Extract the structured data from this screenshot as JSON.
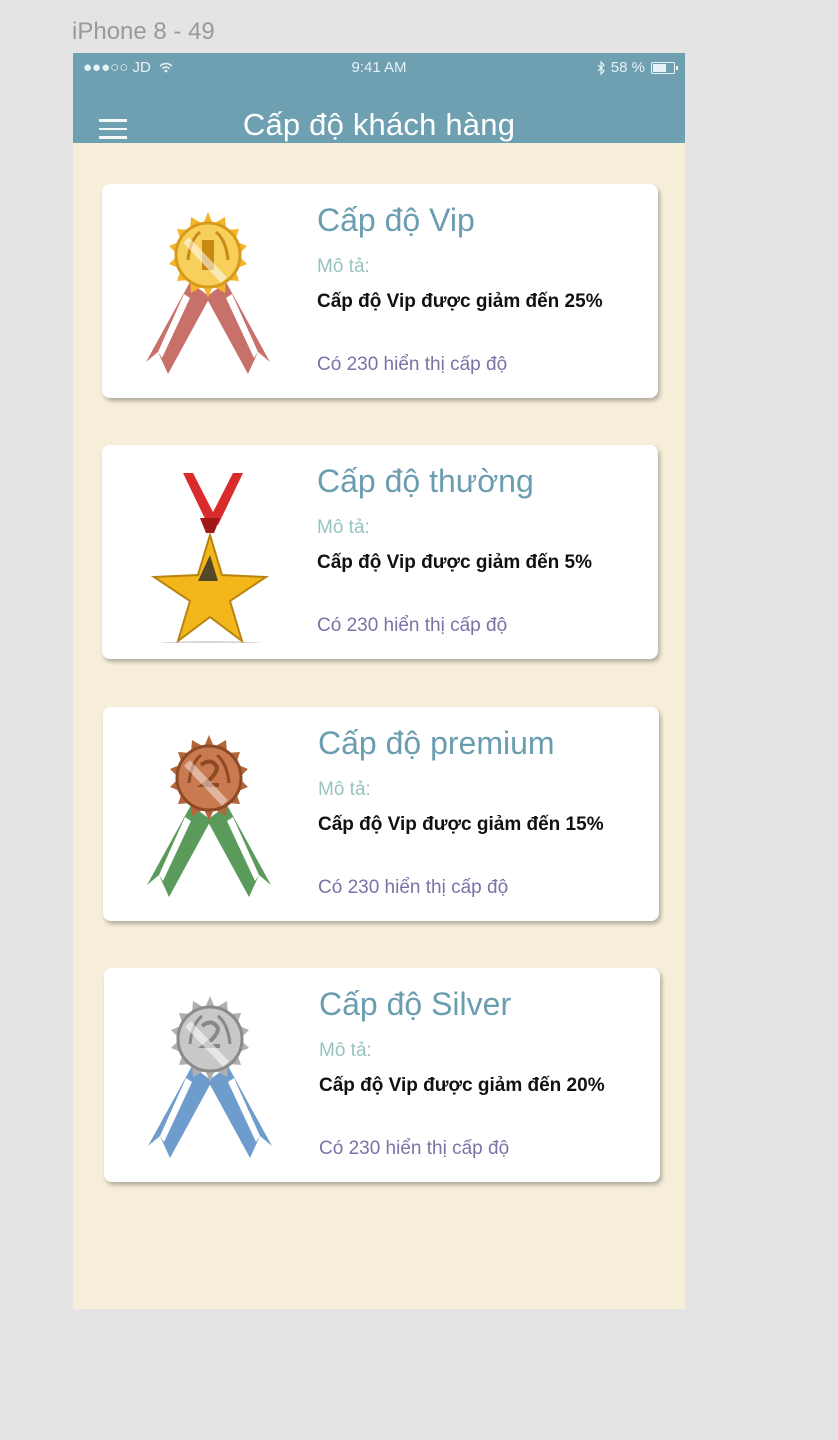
{
  "artboard_label": "iPhone 8 - 49",
  "status_bar": {
    "carrier": "●●●○○ JD",
    "wifi_icon": "wifi-icon",
    "time": "9:41 AM",
    "bluetooth_icon": "bluetooth-icon",
    "battery": "58 %"
  },
  "header": {
    "title": "Cấp độ khách hàng",
    "menu_icon": "hamburger-menu-icon"
  },
  "colors": {
    "nav_bar": "#6ea0b1",
    "background": "#f6eed9",
    "card_title": "#6a9db0",
    "desc_label": "#97c4bf",
    "count_text": "#7b72a6"
  },
  "levels": [
    {
      "title": "Cấp độ Vip",
      "desc_label": "Mô tả:",
      "desc": "Cấp độ Vip được giảm đến 25%",
      "count": "Có 230 hiển thị cấp độ",
      "icon": "gold-medal-icon"
    },
    {
      "title": "Cấp độ thường",
      "desc_label": "Mô tả:",
      "desc": "Cấp độ Vip được giảm đến 5%",
      "count": "Có 230 hiển thị cấp độ",
      "icon": "gold-star-medal-icon"
    },
    {
      "title": "Cấp độ premium",
      "desc_label": "Mô tả:",
      "desc": "Cấp độ Vip được giảm đến 15%",
      "count": "Có 230 hiển thị cấp độ",
      "icon": "bronze-medal-icon"
    },
    {
      "title": "Cấp độ Silver",
      "desc_label": "Mô tả:",
      "desc": "Cấp độ Vip được giảm đến 20%",
      "count": "Có 230 hiển thị cấp độ",
      "icon": "silver-medal-icon"
    }
  ]
}
